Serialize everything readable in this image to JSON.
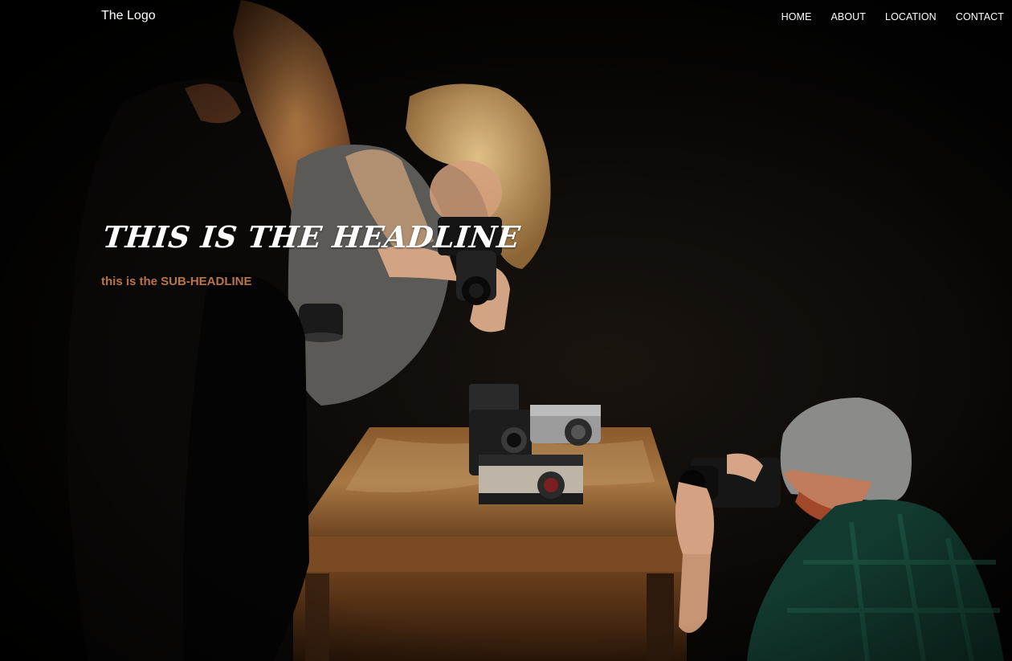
{
  "header": {
    "logo_text": "The Logo",
    "nav": [
      {
        "label": "HOME"
      },
      {
        "label": "ABOUT"
      },
      {
        "label": "LOCATION"
      },
      {
        "label": "CONTACT"
      }
    ]
  },
  "hero": {
    "headline": "THIS IS THE HEADLINE",
    "subheadline": "this is the SUB-HEADLINE",
    "colors": {
      "background": "#000000",
      "headline": "#ffffff",
      "subheadline": "#b8744a",
      "nav_text": "#ffffff"
    }
  }
}
